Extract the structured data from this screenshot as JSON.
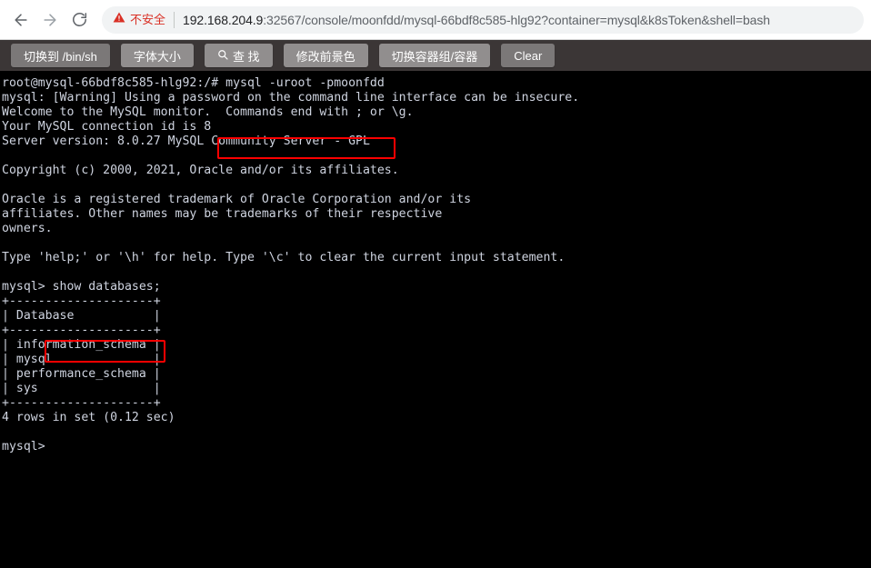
{
  "browser": {
    "back_icon": "arrow-left-icon",
    "forward_icon": "arrow-right-icon",
    "reload_icon": "reload-icon",
    "security_label": "不安全",
    "security_icon": "warning-triangle-icon",
    "url_host": "192.168.204.9",
    "url_rest": ":32567/console/moonfdd/mysql-66bdf8c585-hlg92?container=mysql&k8sToken&shell=bash",
    "url_full": "192.168.204.9:32567/console/moonfdd/mysql-66bdf8c585-hlg92?container=mysql&k8sToken&shell=bash"
  },
  "toolbar": {
    "buttons": [
      {
        "label": "切换到 /bin/sh",
        "name": "switch-shell-button",
        "icon": "",
        "style": "dim"
      },
      {
        "label": "字体大小",
        "name": "font-size-button",
        "icon": "",
        "style": "normal"
      },
      {
        "label": "查 找",
        "name": "find-button",
        "icon": "search-icon",
        "style": "normal"
      },
      {
        "label": "修改前景色",
        "name": "foreground-color-button",
        "icon": "",
        "style": "normal"
      },
      {
        "label": "切换容器组/容器",
        "name": "switch-container-button",
        "icon": "",
        "style": "normal"
      },
      {
        "label": "Clear",
        "name": "clear-button",
        "icon": "",
        "style": "dim"
      }
    ]
  },
  "terminal": {
    "foreground_color": "#cfd4e0",
    "background_color": "#000000",
    "highlight_color": "#ff0000",
    "lines": [
      "root@mysql-66bdf8c585-hlg92:/# mysql -uroot -pmoonfdd",
      "mysql: [Warning] Using a password on the command line interface can be insecure.",
      "Welcome to the MySQL monitor.  Commands end with ; or \\g.",
      "Your MySQL connection id is 8",
      "Server version: 8.0.27 MySQL Community Server - GPL",
      "",
      "Copyright (c) 2000, 2021, Oracle and/or its affiliates.",
      "",
      "Oracle is a registered trademark of Oracle Corporation and/or its",
      "affiliates. Other names may be trademarks of their respective",
      "owners.",
      "",
      "Type 'help;' or '\\h' for help. Type '\\c' to clear the current input statement.",
      "",
      "mysql> show databases;",
      "+--------------------+",
      "| Database           |",
      "+--------------------+",
      "| information_schema |",
      "| mysql              |",
      "| performance_schema |",
      "| sys                |",
      "+--------------------+",
      "4 rows in set (0.12 sec)",
      "",
      "mysql>"
    ],
    "prompt_host": "root@mysql-66bdf8c585-hlg92:/#",
    "highlighted_commands": [
      "mysql -uroot -pmoonfdd",
      "show databases;"
    ],
    "result_table": {
      "header": "Database",
      "rows": [
        "information_schema",
        "mysql",
        "performance_schema",
        "sys"
      ],
      "row_count_text": "4 rows in set (0.12 sec)"
    },
    "mysql_prompt": "mysql>"
  }
}
